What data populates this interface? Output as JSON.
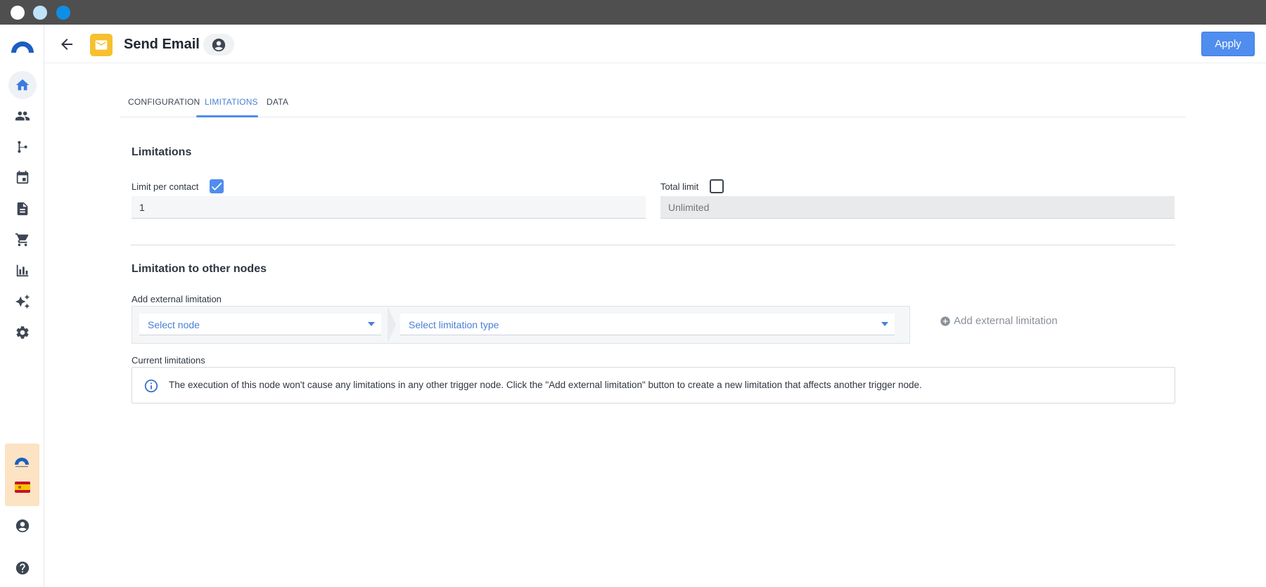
{
  "header": {
    "title": "Send Email",
    "apply_label": "Apply"
  },
  "sidebar": {
    "items": [
      {
        "icon": "home-icon",
        "active": true
      },
      {
        "icon": "users-icon"
      },
      {
        "icon": "flow-icon"
      },
      {
        "icon": "calendar-icon"
      },
      {
        "icon": "document-icon"
      },
      {
        "icon": "cart-icon"
      },
      {
        "icon": "bar-chart-icon"
      },
      {
        "icon": "sparkle-icon"
      },
      {
        "icon": "gear-icon"
      }
    ],
    "bottom": [
      "account-icon",
      "help-icon"
    ]
  },
  "tabs": [
    {
      "label": "CONFIGURATION",
      "active": false
    },
    {
      "label": "LIMITATIONS",
      "active": true
    },
    {
      "label": "DATA",
      "active": false
    }
  ],
  "limitations": {
    "title": "Limitations",
    "per_contact_label": "Limit per contact",
    "per_contact_checked": true,
    "per_contact_value": "1",
    "total_label": "Total limit",
    "total_checked": false,
    "total_placeholder": "Unlimited"
  },
  "other_nodes": {
    "title": "Limitation to other nodes",
    "add_external_label": "Add external limitation",
    "select_node": "Select node",
    "select_type": "Select limitation type",
    "add_button": "Add external limitation",
    "current_label": "Current limitations",
    "info_text": "The execution of this node won't cause any limitations in any other trigger node. Click the \"Add external limitation\" button to create a new limitation that affects another trigger node."
  },
  "colors": {
    "accent": "#4f8def",
    "email_badge": "#f6c02e",
    "titlebar": "#4f4f4f"
  }
}
